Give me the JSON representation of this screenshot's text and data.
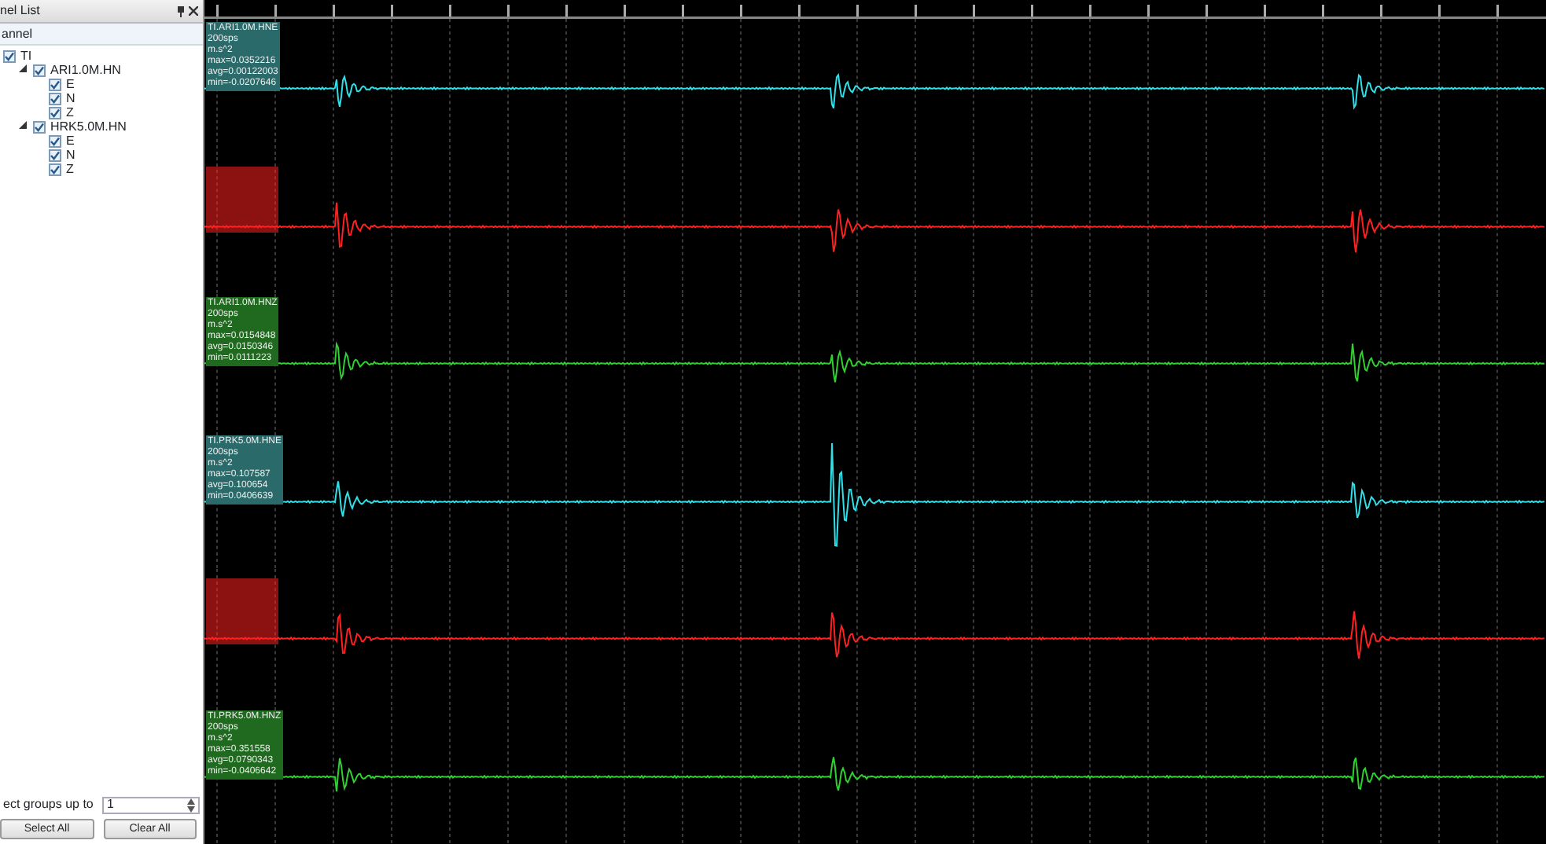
{
  "panel": {
    "title": "nel List",
    "column_header": "annel"
  },
  "tree": [
    {
      "label": "TI",
      "checked": true,
      "children": [
        {
          "label": "ARI1.0M.HN",
          "checked": true,
          "expanded": true,
          "children": [
            {
              "label": "E",
              "checked": true
            },
            {
              "label": "N",
              "checked": true
            },
            {
              "label": "Z",
              "checked": true
            }
          ]
        },
        {
          "label": "HRK5.0M.HN",
          "checked": true,
          "expanded": true,
          "children": [
            {
              "label": "E",
              "checked": true
            },
            {
              "label": "N",
              "checked": true
            },
            {
              "label": "Z",
              "checked": true
            }
          ]
        }
      ]
    }
  ],
  "group_control": {
    "label": "ect groups up to",
    "value": "1"
  },
  "buttons": [
    "Select All",
    "Clear All"
  ],
  "traces": [
    {
      "kind": "readable",
      "color": "#30e0e8",
      "label_lines": [
        "TI.ARI1.0M.HNE",
        "200sps",
        "m.s^2",
        "max=0.0352216",
        "avg=0.00122003",
        "min=-0.0207646"
      ]
    },
    {
      "kind": "obscured",
      "color": "#ff2020"
    },
    {
      "kind": "readable",
      "color": "#30d030",
      "label_lines": [
        "TI.ARI1.0M.HNZ",
        "200sps",
        "m.s^2",
        "max=0.0154848",
        "avg=0.0150346",
        "min=0.0111223"
      ]
    },
    {
      "kind": "readable",
      "color": "#30e0e8",
      "label_lines": [
        "TI.PRK5.0M.HNE",
        "200sps",
        "m.s^2",
        "max=0.107587",
        "avg=0.100654",
        "min=0.0406639"
      ]
    },
    {
      "kind": "obscured",
      "color": "#ff2020"
    },
    {
      "kind": "readable",
      "color": "#30d030",
      "label_lines": [
        "TI.PRK5.0M.HNZ",
        "200sps",
        "m.s^2",
        "max=0.351558",
        "avg=0.0790343",
        "min=-0.0406642"
      ]
    }
  ]
}
